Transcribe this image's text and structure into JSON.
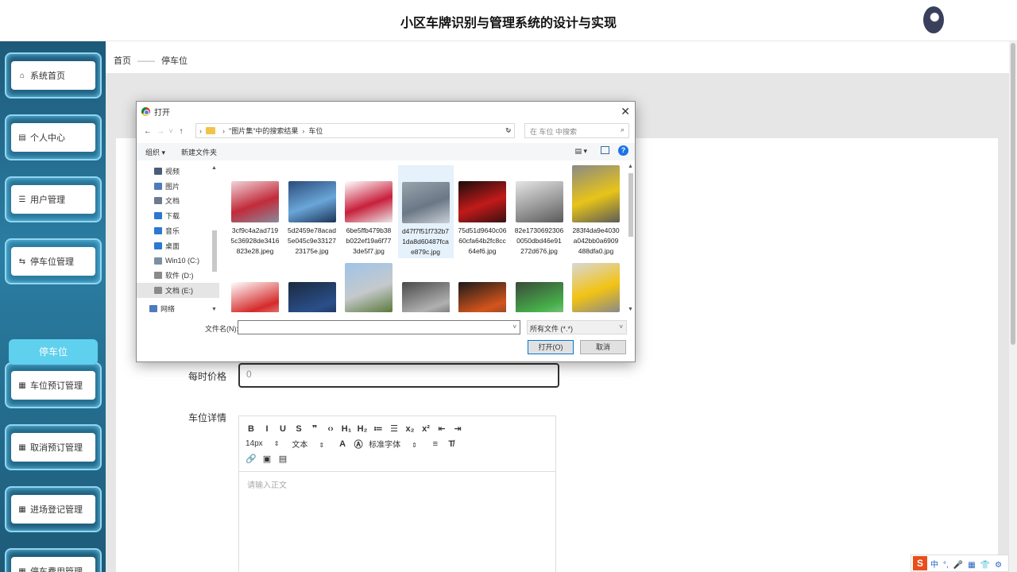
{
  "header": {
    "title": "小区车牌识别与管理系统的设计与实现"
  },
  "sidebar": {
    "items": [
      {
        "label": "系统首页",
        "icon": "home-icon",
        "glyph": "⌂"
      },
      {
        "label": "个人中心",
        "icon": "profile-icon",
        "glyph": "▤"
      },
      {
        "label": "用户管理",
        "icon": "list-icon",
        "glyph": "☰"
      },
      {
        "label": "停车位管理",
        "icon": "parking-admin-icon",
        "glyph": "⇆"
      },
      {
        "label": "车位预订管理",
        "icon": "grid-icon",
        "glyph": "▦"
      },
      {
        "label": "取消预订管理",
        "icon": "grid-icon",
        "glyph": "▦"
      },
      {
        "label": "进场登记管理",
        "icon": "grid-icon",
        "glyph": "▦"
      },
      {
        "label": "停车费用管理",
        "icon": "grid-icon",
        "glyph": "▦"
      }
    ],
    "active_sub": "停车位"
  },
  "breadcrumb": {
    "home": "首页",
    "sep": "——",
    "current": "停车位"
  },
  "form": {
    "price_label": "每时价格",
    "price_value": "0",
    "detail_label": "车位详情",
    "editor": {
      "row1": [
        "B",
        "I",
        "U",
        "S",
        "❞",
        "‹›",
        "H₁",
        "H₂",
        "≔",
        "☰",
        "x₂",
        "x²",
        "⇤",
        "⇥"
      ],
      "font_size": "14px",
      "text_type": "文本",
      "font_family": "标准字体",
      "row3": [
        "🔗",
        "▣",
        "▤"
      ],
      "placeholder": "请输入正文"
    }
  },
  "dialog": {
    "title": "打开",
    "path_root": "\"图片集\"中的搜索结果",
    "path_current": "车位",
    "search_placeholder": "在 车位 中搜索",
    "organize": "组织 ▾",
    "new_folder": "新建文件夹",
    "nav_items": [
      {
        "label": "视频",
        "color": "#4a5d78"
      },
      {
        "label": "图片",
        "color": "#4f7bbd"
      },
      {
        "label": "文档",
        "color": "#6b7a8f"
      },
      {
        "label": "下载",
        "color": "#2b79d0"
      },
      {
        "label": "音乐",
        "color": "#2b79d0"
      },
      {
        "label": "桌面",
        "color": "#2b79d0"
      },
      {
        "label": "Win10 (C:)",
        "color": "#7c8fa3"
      },
      {
        "label": "软件 (D:)",
        "color": "#8a8a8a"
      },
      {
        "label": "文档 (E:)",
        "color": "#8a8a8a"
      },
      {
        "label": "网络",
        "color": "#4f7bbd"
      }
    ],
    "selected_nav": 8,
    "files": [
      {
        "name": "3cf9c4a2ad7195c36928de3416823e28.jpeg",
        "l1": "3cf9c4a2ad719",
        "l2": "5c36928de3416",
        "l3": "823e28.jpeg",
        "colors": [
          "#f0d4d8",
          "#c22b3b",
          "#8a8a9a"
        ]
      },
      {
        "name": "5d2459e78acad5e045c9e3312723175e.jpg",
        "l1": "5d2459e78acad",
        "l2": "5e045c9e33127",
        "l3": "23175e.jpg",
        "colors": [
          "#2a4c7a",
          "#6aa6d8",
          "#1c3358"
        ]
      },
      {
        "name": "6be5ffb479b38b022ef19a6f773de5f7.jpg",
        "l1": "6be5ffb479b38",
        "l2": "b022ef19a6f77",
        "l3": "3de5f7.jpg",
        "colors": [
          "#ffffff",
          "#c8203c",
          "#e8e8e8"
        ]
      },
      {
        "name": "d47f7f51f732b71da8d60487fcae879c.jpg",
        "l1": "d47f7f51f732b7",
        "l2": "1da8d60487fca",
        "l3": "e879c.jpg",
        "colors": [
          "#9aa4ad",
          "#6a7785",
          "#c9d0d6"
        ]
      },
      {
        "name": "75d51d9640c0660cfa64b2fc8cc64ef6.jpg",
        "l1": "75d51d9640c06",
        "l2": "60cfa64b2fc8cc",
        "l3": "64ef6.jpg",
        "colors": [
          "#1a0c0c",
          "#c21a1a",
          "#3a1010"
        ]
      },
      {
        "name": "82e17306923060050dbd46e91272d676.jpg",
        "l1": "82e1730692306",
        "l2": "0050dbd46e91",
        "l3": "272d676.jpg",
        "colors": [
          "#e5e5e5",
          "#9a9a9a",
          "#5a5a5a"
        ]
      },
      {
        "name": "283f4da9e4030a042bb0a6909488dfa0.jpg",
        "l1": "283f4da9e4030",
        "l2": "a042bb0a6909",
        "l3": "488dfa0.jpg",
        "colors": [
          "#8a8a86",
          "#e8c418",
          "#5c5c58"
        ]
      },
      {
        "name": "",
        "l1": "",
        "l2": "",
        "l3": "",
        "colors": [
          "#ffffff",
          "#d52a2a",
          "#ececec"
        ]
      },
      {
        "name": "",
        "l1": "",
        "l2": "",
        "l3": "",
        "colors": [
          "#1b2a3f",
          "#2a4f8a",
          "#0e1622"
        ]
      },
      {
        "name": "",
        "l1": "",
        "l2": "",
        "l3": "",
        "colors": [
          "#9ec4e8",
          "#c5c9cc",
          "#5a7a3a"
        ]
      },
      {
        "name": "",
        "l1": "",
        "l2": "",
        "l3": "",
        "colors": [
          "#4a4a4a",
          "#b0b0b0",
          "#2a2a2a"
        ]
      },
      {
        "name": "",
        "l1": "",
        "l2": "",
        "l3": "",
        "colors": [
          "#1a1a1a",
          "#d4541c",
          "#3a3a3a"
        ]
      },
      {
        "name": "",
        "l1": "",
        "l2": "",
        "l3": "",
        "colors": [
          "#3a4a3a",
          "#47b04a",
          "#d8d8d8"
        ]
      },
      {
        "name": "",
        "l1": "",
        "l2": "",
        "l3": "",
        "colors": [
          "#d8d8d8",
          "#f2c314",
          "#8a8a8a"
        ]
      }
    ],
    "selected_file": 3,
    "filename_label": "文件名(N):",
    "filename_value": "",
    "filetype": "所有文件 (*.*)",
    "open_label": "打开(O)",
    "cancel_label": "取消"
  },
  "ime": {
    "brand": "S",
    "glyphs": [
      "中",
      "°,",
      "🎤",
      "▦",
      "👕",
      "⚙"
    ]
  }
}
